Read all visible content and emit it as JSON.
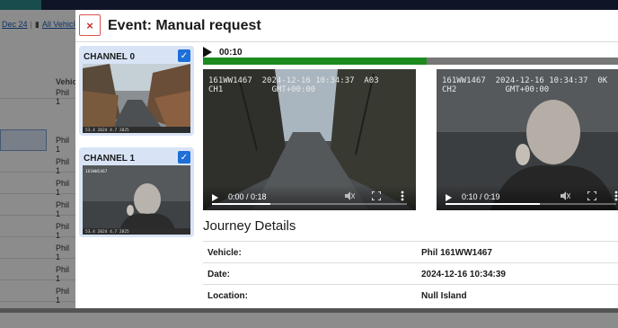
{
  "background": {
    "toolbar": {
      "date_label": "Dec 24",
      "separator": "|",
      "vehicles_label": "All Vehicle"
    },
    "column_header": "Vehic",
    "rows": [
      "Phil 1",
      "Phil 1",
      "Phil 1",
      "Phil 1",
      "Phil 1",
      "Phil 1",
      "Phil 1",
      "Phil 1",
      "Phil 1"
    ]
  },
  "modal": {
    "close_glyph": "×",
    "title": "Event: Manual request"
  },
  "channels": [
    {
      "label": "CHANNEL 0",
      "checked": true,
      "check_glyph": "✓",
      "osd_footer": "53.4 2024  4.7  2025"
    },
    {
      "label": "CHANNEL 1",
      "checked": true,
      "check_glyph": "✓",
      "osd_top": "161WW1467\nCH2",
      "osd_footer": "53.4 2024  4.7  2025"
    }
  ],
  "player": {
    "time": "00:10",
    "progress": 0.54
  },
  "videos": [
    {
      "osd": "161WW1467  2024-12-16 10:34:37  A03\nCH1          GMT+00:00",
      "time": "0:00 / 0:18",
      "progress": 0.3
    },
    {
      "osd": "161WW1467  2024-12-16 10:34:37  0K\nCH2          GMT+00:00",
      "time": "0:10 / 0:19",
      "progress": 0.55
    }
  ],
  "journey": {
    "heading": "Journey Details",
    "rows": [
      {
        "key": "Vehicle:",
        "value": "Phil 161WW1467"
      },
      {
        "key": "Date:",
        "value": "2024-12-16 10:34:39"
      },
      {
        "key": "Location:",
        "value": "Null Island"
      }
    ]
  },
  "colors": {
    "accent_blue": "#1f6fd8",
    "progress_green": "#1d8a1d",
    "close_red": "#c9302c",
    "channel_card_bg": "#d8e4f6"
  }
}
